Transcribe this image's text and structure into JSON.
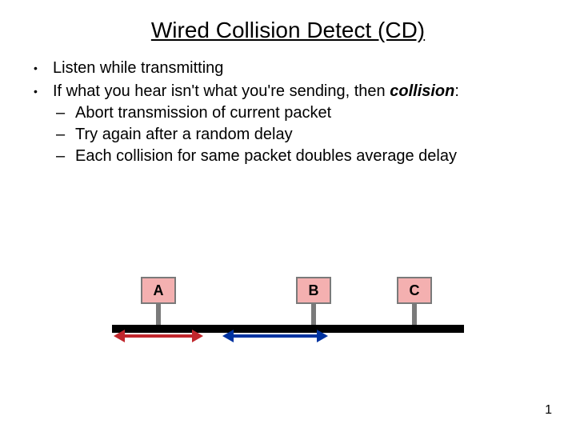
{
  "title": "Wired Collision Detect (CD)",
  "bullets": {
    "b1": "Listen while transmitting",
    "b2_pre": "If what you hear isn't what you're sending, then ",
    "b2_em": "collision",
    "b2_post": ":",
    "s1": "Abort transmission of current packet",
    "s2": "Try again after a random delay",
    "s3": "Each collision for same packet doubles average delay"
  },
  "nodes": {
    "a": "A",
    "b": "B",
    "c": "C"
  },
  "page": "1"
}
